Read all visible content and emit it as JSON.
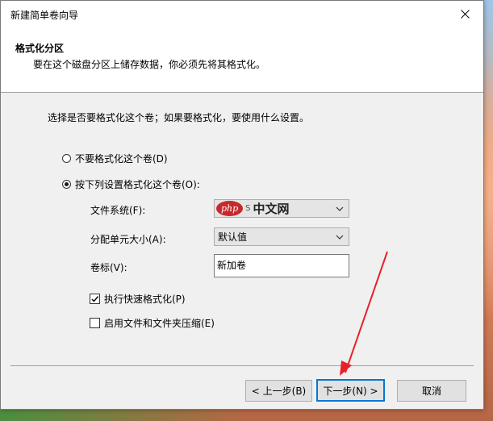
{
  "window": {
    "title": "新建简单卷向导"
  },
  "header": {
    "title": "格式化分区",
    "subtitle": "要在这个磁盘分区上储存数据，你必须先将其格式化。"
  },
  "body": {
    "instruction": "选择是否要格式化这个卷；如果要格式化，要使用什么设置。",
    "radio_no_format": "不要格式化这个卷(D)",
    "radio_format": "按下列设置格式化这个卷(O):",
    "filesystem_label": "文件系统(F):",
    "filesystem_value": "",
    "allocation_label": "分配单元大小(A):",
    "allocation_value": "默认值",
    "volume_label": "卷标(V):",
    "volume_value": "新加卷",
    "quick_format_label": "执行快速格式化(P)",
    "compression_label": "启用文件和文件夹压缩(E)"
  },
  "watermark": {
    "logo": "php",
    "text": "中文网",
    "partial": "S"
  },
  "buttons": {
    "back": "< 上一步(B)",
    "next": "下一步(N) >",
    "cancel": "取消"
  },
  "colors": {
    "accent": "#0078d7",
    "arrow": "#e8202a"
  }
}
